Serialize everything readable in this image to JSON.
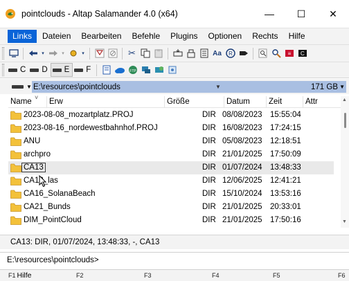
{
  "window": {
    "title": "pointclouds - Altap Salamander 4.0 (x64)",
    "minimize": "—",
    "maximize": "☐",
    "close": "✕"
  },
  "menu": [
    "Links",
    "Dateien",
    "Bearbeiten",
    "Befehle",
    "Plugins",
    "Optionen",
    "Rechts",
    "Hilfe"
  ],
  "drives": [
    "C",
    "D",
    "E",
    "F"
  ],
  "path": {
    "value": "E:\\resources\\pointclouds",
    "free_space": "171 GB"
  },
  "columns": {
    "name": "Name",
    "ext": "Erw",
    "size": "Größe",
    "date": "Datum",
    "time": "Zeit",
    "attr": "Attr"
  },
  "files": [
    {
      "name": "2023-08-08_mozartplatz.PROJ",
      "size": "DIR",
      "date": "08/08/2023",
      "time": "15:55:04"
    },
    {
      "name": "2023-08-16_nordewestbahnhof.PROJ",
      "size": "DIR",
      "date": "16/08/2023",
      "time": "17:24:15"
    },
    {
      "name": "ANU",
      "size": "DIR",
      "date": "05/08/2023",
      "time": "12:18:51"
    },
    {
      "name": "archpro",
      "size": "DIR",
      "date": "21/01/2025",
      "time": "17:50:09"
    },
    {
      "name": "CA13",
      "size": "DIR",
      "date": "01/07/2024",
      "time": "13:48:33"
    },
    {
      "name": "CA13_las",
      "size": "DIR",
      "date": "12/06/2025",
      "time": "12:41:21"
    },
    {
      "name": "CA16_SolanaBeach",
      "size": "DIR",
      "date": "15/10/2024",
      "time": "13:53:16"
    },
    {
      "name": "CA21_Bunds",
      "size": "DIR",
      "date": "21/01/2025",
      "time": "20:33:01"
    },
    {
      "name": "DIM_PointCloud",
      "size": "DIR",
      "date": "21/01/2025",
      "time": "17:50:16"
    }
  ],
  "status": "CA13: DIR, 01/07/2024, 13:48:33, -, CA13",
  "command_line": "E:\\resources\\pointclouds>",
  "fkeys": [
    {
      "key": "F1",
      "label": "Hilfe"
    },
    {
      "key": "F2",
      "label": ""
    },
    {
      "key": "F3",
      "label": ""
    },
    {
      "key": "F4",
      "label": ""
    },
    {
      "key": "F5",
      "label": ""
    },
    {
      "key": "F6",
      "label": ""
    }
  ],
  "colors": {
    "menu_active": "#0a64d8",
    "path_bar": "#a9bfe2",
    "folder": "#f3c13a"
  }
}
